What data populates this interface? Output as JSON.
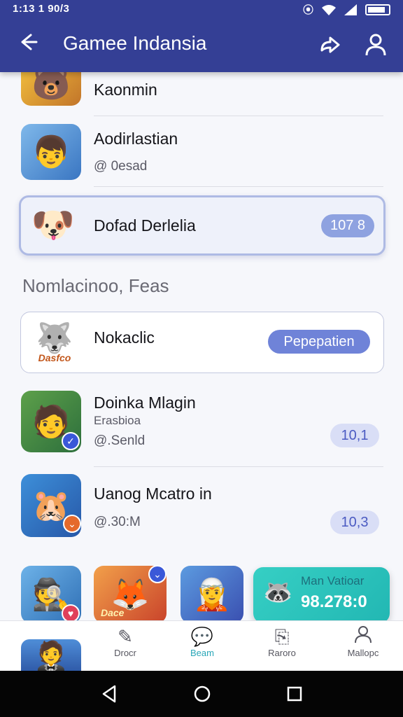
{
  "status_bar": {
    "time": "1:13 1 90/3"
  },
  "header": {
    "title": "Gamee Indansia",
    "back_icon": "arrow-left-icon",
    "share_icon": "share-icon",
    "profile_icon": "person-icon"
  },
  "list_top": [
    {
      "title": "Kaonmin",
      "icon": "game-art-icon"
    },
    {
      "title": "Aodirlastian",
      "subtitle": "@ 0esad",
      "icon": "game-art-icon"
    }
  ],
  "highlight_card": {
    "title": "Dofad Derlelia",
    "badge": "107 8"
  },
  "section": {
    "title": "Nomlacinoo, Feas"
  },
  "feature_card": {
    "title": "Nokaclic",
    "button": "Pepeрatien",
    "icon_caption": "Dasfco"
  },
  "list_bottom": [
    {
      "title": "Doinka Mlagin",
      "subtitle1": "Erasbioa",
      "subtitle2": "@.Senld",
      "badge": "10,1"
    },
    {
      "title": "Uanog Mcatro in",
      "subtitle2": "@.30:M",
      "badge": "10,3"
    }
  ],
  "thumb_caption": "Dace",
  "promo": {
    "label": "Man Vatioar",
    "value": "98.278:0"
  },
  "bottom_nav": [
    {
      "label": "Drocr",
      "icon": "gamepad-icon"
    },
    {
      "label": "Beam",
      "icon": "chat-icon"
    },
    {
      "label": "Raroro",
      "icon": "bookmark-icon"
    },
    {
      "label": "Mallopc",
      "icon": "person-icon"
    }
  ],
  "colors": {
    "header": "#343f95",
    "accent": "#2aa7b8",
    "pill": "#d9def6",
    "pill_solid": "#6f83d8",
    "promo": "#36cfc4"
  }
}
